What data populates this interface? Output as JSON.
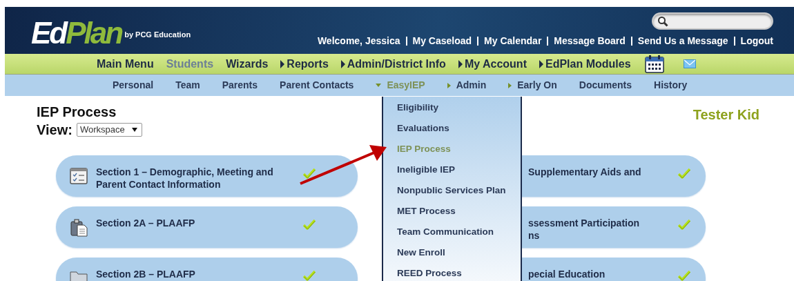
{
  "logo": {
    "first": "Ed",
    "second": "Plan",
    "byline": "by PCG Education"
  },
  "welcome": "Welcome, Jessica",
  "top_links": [
    "My Caseload",
    "My Calendar",
    "Message Board",
    "Send Us a Message",
    "Logout"
  ],
  "main_nav": [
    {
      "label": "Main Menu",
      "kind": "link",
      "selected": false
    },
    {
      "label": "Students",
      "kind": "link",
      "selected": true
    },
    {
      "label": "Wizards",
      "kind": "link",
      "selected": false
    },
    {
      "label": "Reports",
      "kind": "submenu",
      "selected": false
    },
    {
      "label": "Admin/District Info",
      "kind": "submenu",
      "selected": false
    },
    {
      "label": "My Account",
      "kind": "submenu",
      "selected": false
    },
    {
      "label": "EdPlan Modules",
      "kind": "submenu",
      "selected": false
    }
  ],
  "sub_nav": [
    {
      "label": "Personal",
      "kind": "link",
      "selected": false
    },
    {
      "label": "Team",
      "kind": "link",
      "selected": false
    },
    {
      "label": "Parents",
      "kind": "link",
      "selected": false
    },
    {
      "label": "Parent Contacts",
      "kind": "link",
      "selected": false
    },
    {
      "label": "EasyIEP",
      "kind": "expanded",
      "selected": true
    },
    {
      "label": "Admin",
      "kind": "submenu",
      "selected": false
    },
    {
      "label": "Early On",
      "kind": "submenu",
      "selected": false
    },
    {
      "label": "Documents",
      "kind": "link",
      "selected": false
    },
    {
      "label": "History",
      "kind": "link",
      "selected": false
    }
  ],
  "page_title": "IEP Process",
  "view": {
    "label": "View:",
    "value": "Workspace"
  },
  "student_name": "Tester Kid",
  "sections_left": [
    {
      "title": "Section 1 – Demographic, Meeting and Parent Contact Information",
      "complete": true
    },
    {
      "title": "Section 2A – PLAAFP",
      "complete": true
    },
    {
      "title": "Section 2B – PLAAFP",
      "complete": true
    }
  ],
  "sections_right": [
    {
      "lines": [
        "Supplementary Aids and"
      ],
      "complete": true
    },
    {
      "lines": [
        "ssessment Participation",
        "ns"
      ],
      "complete": true
    },
    {
      "lines": [
        "pecial Education"
      ],
      "complete": true
    }
  ],
  "dropdown": [
    {
      "label": "Eligibility",
      "selected": false
    },
    {
      "label": "Evaluations",
      "selected": false
    },
    {
      "label": "IEP Process",
      "selected": true
    },
    {
      "label": "Ineligible IEP",
      "selected": false
    },
    {
      "label": "Nonpublic Services Plan",
      "selected": false
    },
    {
      "label": "MET Process",
      "selected": false
    },
    {
      "label": "Team Communication",
      "selected": false
    },
    {
      "label": "New Enroll",
      "selected": false
    },
    {
      "label": "REED Process",
      "selected": false
    }
  ]
}
